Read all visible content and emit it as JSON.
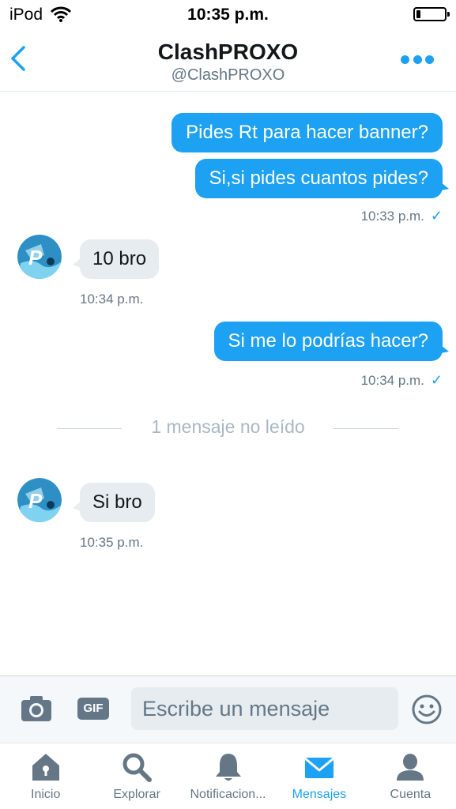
{
  "status_bar": {
    "carrier": "iPod",
    "time": "10:35 p.m.",
    "battery_level": 0.15
  },
  "header": {
    "name": "ClashPROXO",
    "handle": "@ClashPROXO",
    "icons": {
      "back": "chevron-left-icon",
      "more": "more-dots-icon"
    }
  },
  "colors": {
    "accent": "#1da1f2",
    "incoming_bubble": "#e6ecf0",
    "secondary_text": "#657786"
  },
  "messages": [
    {
      "direction": "outgoing",
      "text": "Pides Rt para hacer banner?"
    },
    {
      "direction": "outgoing",
      "text": "Si,si pides cuantos pides?",
      "time": "10:33 p.m.",
      "read": true
    },
    {
      "direction": "incoming",
      "text": "10 bro",
      "time": "10:34 p.m."
    },
    {
      "direction": "outgoing",
      "text": "Si me lo podrías hacer?",
      "time": "10:34 p.m.",
      "read": true
    },
    {
      "direction": "incoming",
      "text": "Si bro",
      "time": "10:35 p.m."
    }
  ],
  "unread_divider": "1 mensaje no leído",
  "composer": {
    "placeholder": "Escribe un mensaje",
    "gif_label": "GIF",
    "icons": {
      "camera": "camera-icon",
      "emoji": "emoji-icon"
    }
  },
  "tabs": [
    {
      "label": "Inicio",
      "icon": "home-icon",
      "active": false
    },
    {
      "label": "Explorar",
      "icon": "search-icon",
      "active": false
    },
    {
      "label": "Notificacion...",
      "icon": "bell-icon",
      "active": false
    },
    {
      "label": "Mensajes",
      "icon": "envelope-icon",
      "active": true
    },
    {
      "label": "Cuenta",
      "icon": "person-icon",
      "active": false
    }
  ]
}
